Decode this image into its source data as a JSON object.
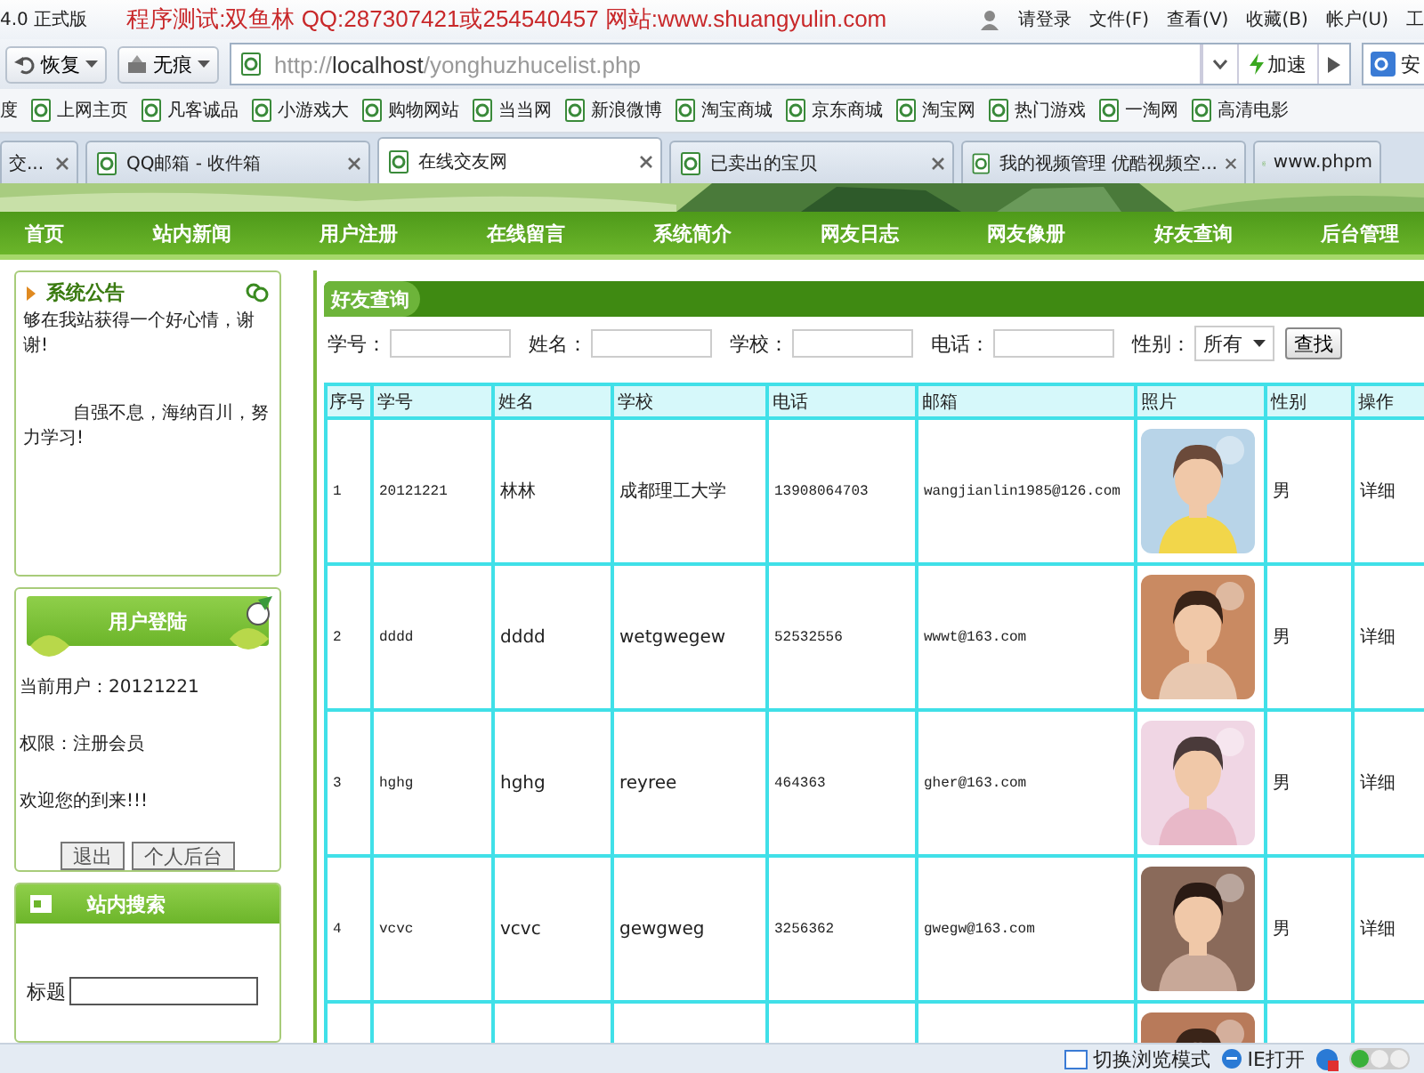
{
  "browser": {
    "title_bar": {
      "version": "4.0 正式版",
      "banner": "程序测试:双鱼林 QQ:287307421或254540457 网站:www.shuangyulin.com",
      "login": "请登录",
      "menu": [
        "文件(F)",
        "查看(V)",
        "收藏(B)",
        "帐户(U)",
        "工"
      ]
    },
    "toolbar": {
      "restore": "恢复",
      "private": "无痕",
      "url": "http://**localhost**/yonghuzhucelist.php",
      "speed": "加速",
      "search_engine": "安"
    },
    "bookmarks": [
      "度",
      "上网主页",
      "凡客诚品",
      "小游戏大",
      "购物网站",
      "当当网",
      "新浪微博",
      "淘宝商城",
      "京东商城",
      "淘宝网",
      "热门游戏",
      "一淘网",
      "高清电影"
    ],
    "tabs": [
      {
        "label": "交...",
        "selected": false
      },
      {
        "label": "QQ邮箱 - 收件箱",
        "selected": false
      },
      {
        "label": "在线交友网",
        "selected": true
      },
      {
        "label": "已卖出的宝贝",
        "selected": false
      },
      {
        "label": "我的视频管理 优酷视频空...",
        "selected": false
      },
      {
        "label": "www.phpm",
        "selected": false
      }
    ]
  },
  "page": {
    "nav": [
      "首页",
      "站内新闻",
      "用户注册",
      "在线留言",
      "系统简介",
      "网友日志",
      "网友像册",
      "好友查询",
      "后台管理"
    ],
    "notice": {
      "title": "系统公告",
      "paragraphs": [
        "够在我站获得一个好心情，谢谢!",
        "自强不息，海纳百川，努力学习!"
      ]
    },
    "login": {
      "title": "用户登陆",
      "lines": [
        "当前用户：20121221",
        "权限：注册会员",
        "欢迎您的到来!!!"
      ],
      "buttons": [
        "退出",
        "个人后台"
      ]
    },
    "site_search": {
      "title": "站内搜索",
      "field_label": "标题"
    },
    "main": {
      "title": "好友查询",
      "filters": [
        {
          "kind": "input",
          "label": "学号："
        },
        {
          "kind": "input",
          "label": "姓名："
        },
        {
          "kind": "input",
          "label": "学校："
        },
        {
          "kind": "input",
          "label": "电话："
        },
        {
          "kind": "select",
          "label": "性别：",
          "value": "所有"
        }
      ],
      "search_button": "查找",
      "table": {
        "columns": [
          "序号",
          "学号",
          "姓名",
          "学校",
          "电话",
          "邮箱",
          "照片",
          "性别",
          "操作"
        ],
        "rows": [
          {
            "cells": [
              "1",
              "20121221",
              "林林",
              "成都理工大学",
              "13908064703",
              "wangjianlin1985@126.com"
            ],
            "photo": {
              "kind": "picture"
            },
            "gender": "男",
            "action": "详细"
          },
          {
            "cells": [
              "2",
              "dddd",
              "dddd",
              "wetgwegew",
              "52532556",
              "wwwt@163.com"
            ],
            "photo": {
              "kind": "picture"
            },
            "gender": "男",
            "action": "详细"
          },
          {
            "cells": [
              "3",
              "hghg",
              "hghg",
              "reyree",
              "464363",
              "gher@163.com"
            ],
            "photo": {
              "kind": "picture"
            },
            "gender": "男",
            "action": "详细"
          },
          {
            "cells": [
              "4",
              "vcvc",
              "vcvc",
              "gewgweg",
              "3256362",
              "gwegw@163.com"
            ],
            "photo": {
              "kind": "picture"
            },
            "gender": "男",
            "action": "详细"
          },
          {
            "photo": {
              "kind": "picture"
            }
          }
        ]
      }
    }
  },
  "status_bar": [
    "切换浏览模式",
    "IE打开"
  ]
}
